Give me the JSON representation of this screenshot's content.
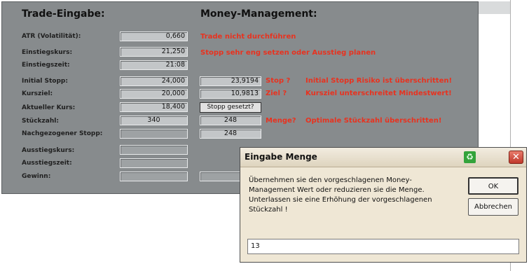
{
  "headers": {
    "trade": "Trade-Eingabe:",
    "money": "Money-Management:"
  },
  "trade": {
    "atr_label": "ATR (Volatilität):",
    "atr_value": "0,660",
    "einstiegskurs_label": "Einstiegskurs:",
    "einstiegskurs_value": "21,250",
    "einstiegszeit_label": "Einstiegszeit:",
    "einstiegszeit_value": "21:08",
    "initial_stopp_label": "Initial Stopp:",
    "initial_stopp_value": "24,000",
    "kursziel_label": "Kursziel:",
    "kursziel_value": "20,000",
    "aktueller_kurs_label": "Aktueller Kurs:",
    "aktueller_kurs_value": "18,400",
    "stueckzahl_label": "Stückzahl:",
    "stueckzahl_value": "340",
    "nachgezogener_label": "Nachgezogener Stopp:",
    "ausstiegskurs_label": "Ausstiegskurs:",
    "ausstiegszeit_label": "Ausstiegszeit:",
    "gewinn_label": "Gewinn:"
  },
  "money": {
    "msg_trade": "Trade nicht durchführen",
    "msg_stopp_eng": "Stopp sehr eng setzen oder Ausstieg planen",
    "stop_value": "23,9194",
    "stop_tag": "Stop ?",
    "stop_msg": "Initial Stopp Risiko ist überschritten!",
    "ziel_value": "10,9813",
    "ziel_tag": "Ziel ?",
    "ziel_msg": "Kursziel unterschreitet Mindestwert!",
    "stopp_gesetzt_button": "Stopp gesetzt?",
    "menge_value": "248",
    "menge_tag": "Menge?",
    "menge_msg": "Optimale Stückzahl überschritten!",
    "nachgezogen_value": "248"
  },
  "dialog": {
    "title": "Eingabe Menge",
    "message": "Übernehmen sie den vorgeschlagenen Money-Management Wert oder reduzieren sie die Menge. Unterlassen sie eine Erhöhung der vorgeschlagenen Stückzahl !",
    "ok_label": "OK",
    "cancel_label": "Abbrechen",
    "input_value": "13",
    "close_symbol": "✕",
    "app_icon_symbol": "♻"
  },
  "icons": {
    "app_icon": "recycle-icon",
    "close": "close-icon"
  },
  "colors": {
    "warning": "#e8321f",
    "panel": "#878b8d",
    "dialog_bg": "#efe7d5"
  }
}
